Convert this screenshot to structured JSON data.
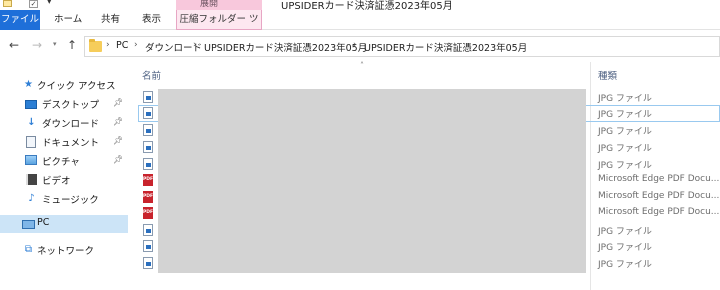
{
  "window": {
    "title": "UPSIDERカード決済証憑2023年05月",
    "context_group_label": "展開"
  },
  "ribbon": {
    "tabs": [
      {
        "label": "ファイル"
      },
      {
        "label": "ホーム"
      },
      {
        "label": "共有"
      },
      {
        "label": "表示"
      },
      {
        "label": "圧縮フォルダー ツール"
      }
    ]
  },
  "address": {
    "segments": [
      "PC",
      "ダウンロード",
      "UPSIDERカード決済証憑2023年05月",
      "UPSIDERカード決済証憑2023年05月"
    ]
  },
  "sidebar": {
    "items": [
      {
        "label": "クイック アクセス",
        "icon": "star-icon"
      },
      {
        "label": "デスクトップ",
        "icon": "desktop-icon",
        "pinned": true
      },
      {
        "label": "ダウンロード",
        "icon": "download-icon",
        "pinned": true
      },
      {
        "label": "ドキュメント",
        "icon": "documents-icon",
        "pinned": true
      },
      {
        "label": "ピクチャ",
        "icon": "pictures-icon",
        "pinned": true
      },
      {
        "label": "ビデオ",
        "icon": "videos-icon"
      },
      {
        "label": "ミュージック",
        "icon": "music-icon"
      },
      {
        "label": "PC",
        "icon": "pc-icon",
        "selected": true
      },
      {
        "label": "ネットワーク",
        "icon": "network-icon"
      }
    ]
  },
  "file_list": {
    "columns": {
      "name": "名前",
      "type": "種類"
    },
    "rows": [
      {
        "type": "JPG ファイル",
        "icon": "jpg-file-icon"
      },
      {
        "type": "JPG ファイル",
        "icon": "jpg-file-icon",
        "focused": true
      },
      {
        "type": "JPG ファイル",
        "icon": "jpg-file-icon"
      },
      {
        "type": "JPG ファイル",
        "icon": "jpg-file-icon"
      },
      {
        "type": "JPG ファイル",
        "icon": "jpg-file-icon"
      },
      {
        "type": "Microsoft Edge PDF Docu...",
        "icon": "pdf-file-icon"
      },
      {
        "type": "Microsoft Edge PDF Docu...",
        "icon": "pdf-file-icon"
      },
      {
        "type": "Microsoft Edge PDF Docu...",
        "icon": "pdf-file-icon"
      },
      {
        "type": "JPG ファイル",
        "icon": "jpg-file-icon"
      },
      {
        "type": "JPG ファイル",
        "icon": "jpg-file-icon"
      },
      {
        "type": "JPG ファイル",
        "icon": "jpg-file-icon"
      }
    ]
  },
  "colors": {
    "file_tab": "#1e6fd9",
    "context_tab": "#f8c8dc",
    "selection": "#cce4f7",
    "redaction": "#d3d3d3"
  }
}
